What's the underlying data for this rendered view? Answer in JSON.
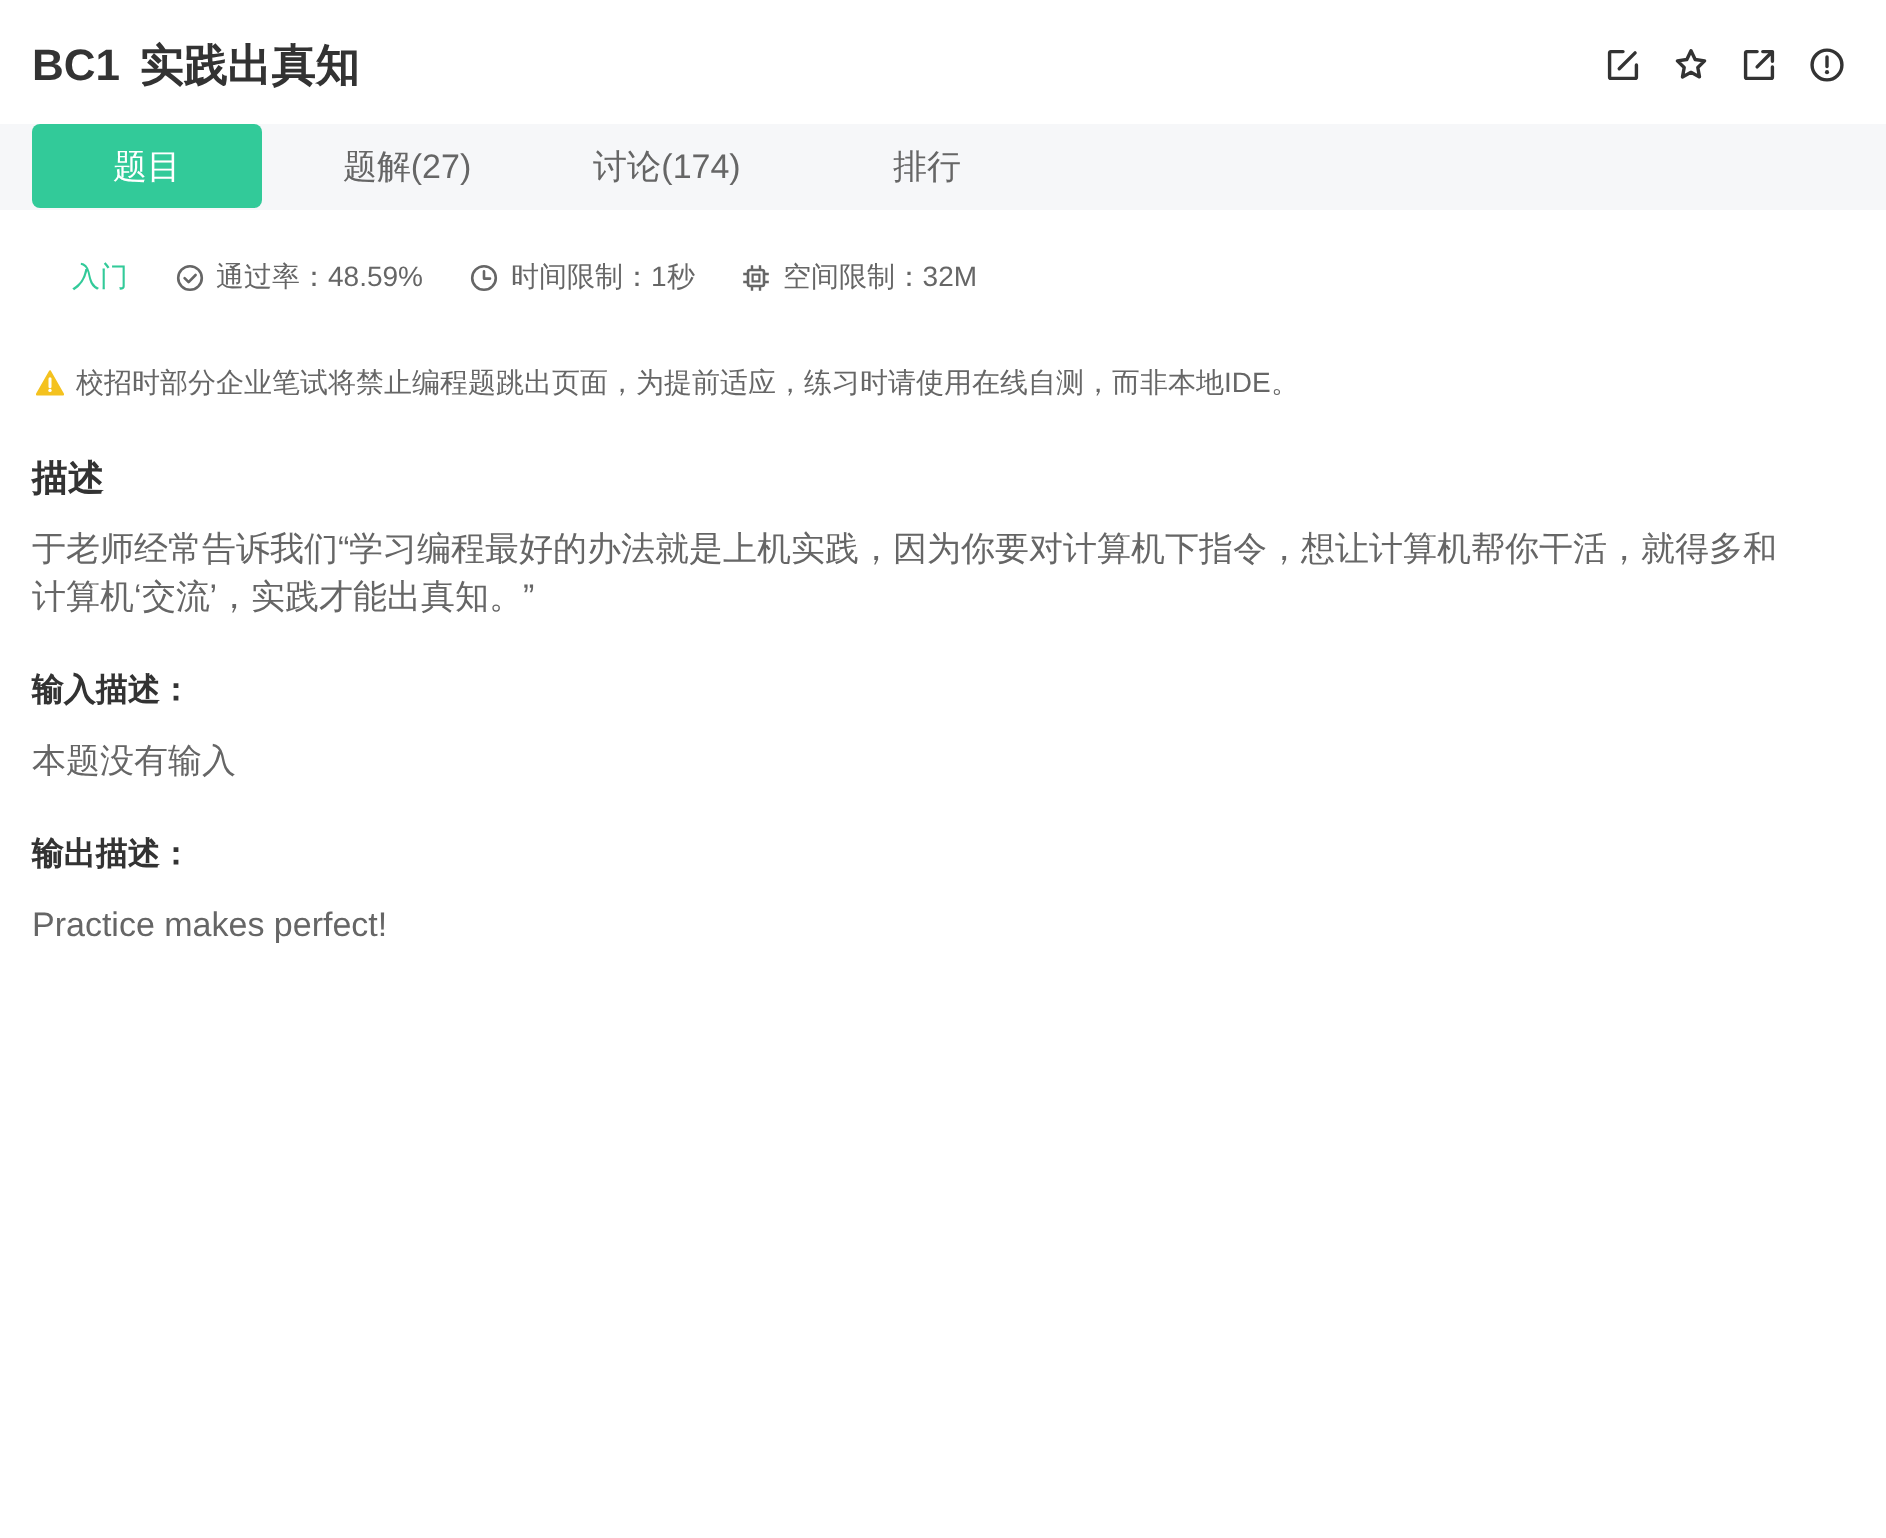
{
  "problem": {
    "code": "BC1",
    "title": "实践出真知"
  },
  "tabs": [
    {
      "label": "题目",
      "selected": true
    },
    {
      "label": "题解(27)",
      "selected": false
    },
    {
      "label": "讨论(174)",
      "selected": false
    },
    {
      "label": "排行",
      "selected": false
    }
  ],
  "meta": {
    "difficulty": "入门",
    "stats": [
      {
        "kind": "pass_rate",
        "text": "通过率：48.59%"
      },
      {
        "kind": "time_limit",
        "text": "时间限制：1秒"
      },
      {
        "kind": "memory_limit",
        "text": "空间限制：32M"
      }
    ]
  },
  "notice": "校招时部分企业笔试将禁止编程题跳出页面，为提前适应，练习时请使用在线自测，而非本地IDE。",
  "description": {
    "heading": "描述",
    "text": "于老师经常告诉我们“学习编程最好的办法就是上机实践，因为你要对计算机下指令，想让计算机帮你干活，就得多和计算机‘交流’，实践才能出真知。”"
  },
  "input_description": {
    "heading": "输入描述：",
    "text": "本题没有输入"
  },
  "output_description": {
    "heading": "输出描述：",
    "text": "Practice makes perfect!"
  }
}
